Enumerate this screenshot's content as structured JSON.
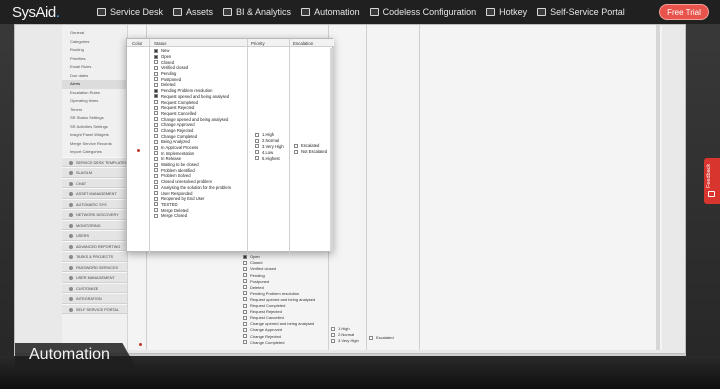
{
  "logo": {
    "text": "SysAid",
    "dot": "."
  },
  "topnav": {
    "items": [
      {
        "label": "Service Desk",
        "icon": "service-desk-icon"
      },
      {
        "label": "Assets",
        "icon": "assets-icon"
      },
      {
        "label": "BI & Analytics",
        "icon": "bi-analytics-icon"
      },
      {
        "label": "Automation",
        "icon": "automation-icon"
      },
      {
        "label": "Codeless Configuration",
        "icon": "codeless-configuration-icon"
      },
      {
        "label": "Hotkey",
        "icon": "hotkey-icon"
      },
      {
        "label": "Self-Service Portal",
        "icon": "self-service-portal-icon"
      }
    ],
    "cta": "Free Trial"
  },
  "leftnav": {
    "subitems": [
      "General",
      "Categories",
      "Routing",
      "Priorities",
      "Email Rules",
      "Due dates",
      "Alerts",
      "Escalation Rules",
      "Operating times",
      "Timers",
      "SR Status Settings",
      "SR Activities Settings",
      "Insight Panel Widgets",
      "Merge Service Records",
      "Import Categories"
    ],
    "selected_index": 6,
    "sections": [
      "SERVICE DESK TEMPLATES",
      "SLA/SLM",
      "CHAT",
      "ASSET MANAGEMENT",
      "AUTOMATIC SYS",
      "NETWORK DISCOVERY",
      "MONITORING",
      "USERS",
      "ADVANCED REPORTING",
      "TASKS & PROJECTS",
      "PASSWORD SERVICES",
      "USER MANAGEMENT",
      "CUSTOMIZE",
      "INTEGRATION",
      "SELF SERVICE PORTAL"
    ]
  },
  "popup": {
    "headers": {
      "color": "Color",
      "status": "Status",
      "priority": "Priority",
      "escalation": "Escalation"
    },
    "statuses": [
      {
        "label": "New",
        "checked": true
      },
      {
        "label": "Open",
        "checked": true
      },
      {
        "label": "Closed",
        "checked": false
      },
      {
        "label": "Verified closed",
        "checked": false
      },
      {
        "label": "Pending",
        "checked": false
      },
      {
        "label": "Postponed",
        "checked": false
      },
      {
        "label": "Deleted",
        "checked": false
      },
      {
        "label": "Pending Problem resolution",
        "checked": true
      },
      {
        "label": "Request opened and being analysed",
        "checked": true
      },
      {
        "label": "Request Completed",
        "checked": false
      },
      {
        "label": "Request Rejected",
        "checked": false
      },
      {
        "label": "Request Cancelled",
        "checked": false
      },
      {
        "label": "Change opened and being analysed",
        "checked": false
      },
      {
        "label": "Change Approved",
        "checked": false
      },
      {
        "label": "Change Rejected",
        "checked": false
      },
      {
        "label": "Change Completed",
        "checked": false
      },
      {
        "label": "Being Analyzed",
        "checked": false
      },
      {
        "label": "In Approval Process",
        "checked": false
      },
      {
        "label": "In Implementation",
        "checked": false
      },
      {
        "label": "In Release",
        "checked": false
      },
      {
        "label": "Waiting to be closed",
        "checked": false
      },
      {
        "label": "Problem Identified",
        "checked": false
      },
      {
        "label": "Problem Solved",
        "checked": false
      },
      {
        "label": "Closed unresolved problem",
        "checked": false
      },
      {
        "label": "Analysing the solution for the problem",
        "checked": false
      },
      {
        "label": "User Responded",
        "checked": false
      },
      {
        "label": "Reopened by End User",
        "checked": false
      },
      {
        "label": "TESTED",
        "checked": false
      },
      {
        "label": "Merge Deleted",
        "checked": false
      },
      {
        "label": "Merge Closed",
        "checked": false
      }
    ],
    "priorities": [
      "1.High",
      "2.Normal",
      "3.Very High",
      "4.Low",
      "5.Highest"
    ],
    "escalations": [
      "Escalated",
      "Not Escalated"
    ]
  },
  "background_table": {
    "header": "Status",
    "statuses": [
      "Open",
      "Closed",
      "Verified closed",
      "Pending",
      "Postponed",
      "Deleted",
      "Pending Problem resolution",
      "Request opened and being analysed",
      "Request Completed",
      "Request Rejected",
      "Request Cancelled",
      "Change opened and being analysed",
      "Change Approved",
      "Change Rejected",
      "Change Completed"
    ],
    "priorities": [
      "1.High",
      "2.Normal",
      "3.Very High"
    ],
    "escalations": [
      "Escalated"
    ]
  },
  "feedback": "Feedback",
  "banner": "Automation",
  "colors": {
    "accent": "#e8544c",
    "feedback": "#d9352f",
    "logo_dot": "#3fb3ff"
  }
}
